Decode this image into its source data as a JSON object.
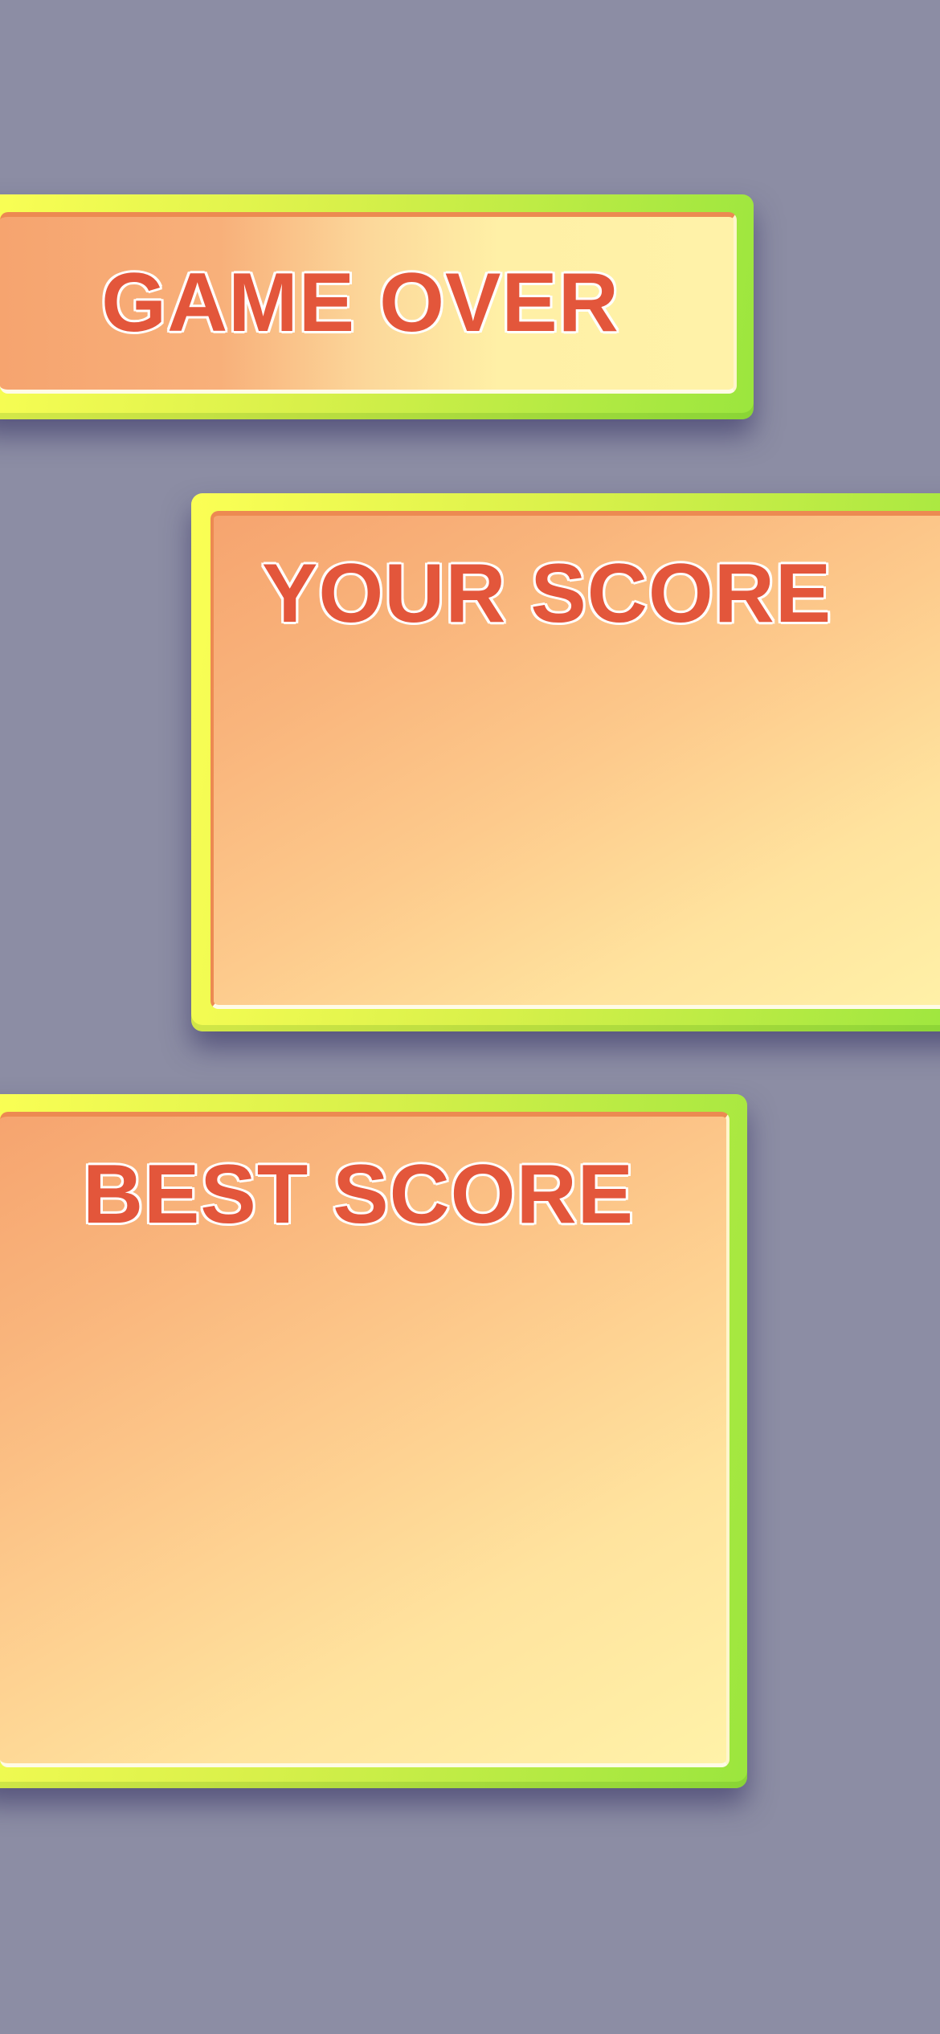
{
  "banner": {
    "title": "GAME OVER"
  },
  "your_score": {
    "title": "YOUR SCORE",
    "value": ""
  },
  "best_score": {
    "title": "BEST SCORE",
    "value": ""
  },
  "colors": {
    "background": "#8c8da4",
    "title_text": "#e3563b",
    "title_outline": "#ffffff",
    "frame_yellow": "#fbff55",
    "frame_green": "#9be63e",
    "fill_orange": "#f6a46f",
    "fill_cream": "#fff2a8"
  }
}
